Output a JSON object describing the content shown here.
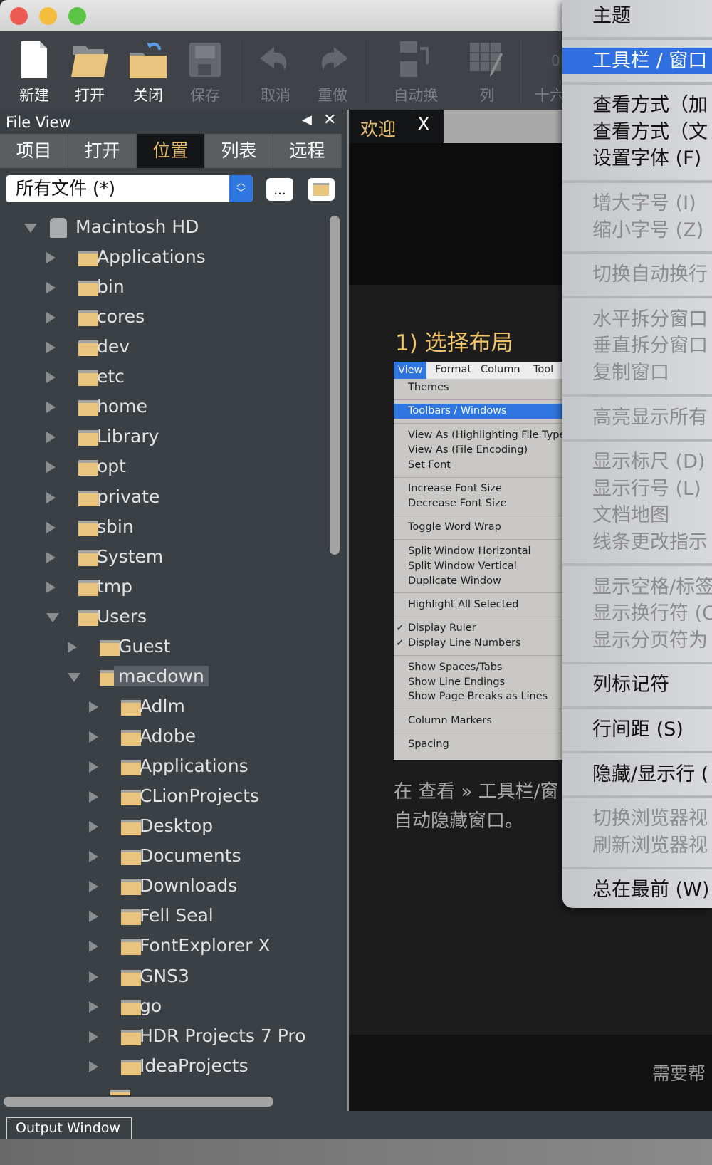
{
  "colors": {
    "accent": "#e8c170",
    "selection": "#2f76e0",
    "folder": "#e9c47d"
  },
  "toolbar": {
    "items": [
      {
        "label": "新建",
        "icon": "new-file-icon",
        "enabled": true
      },
      {
        "label": "打开",
        "icon": "open-folder-icon",
        "enabled": true
      },
      {
        "label": "关闭",
        "icon": "close-folder-icon",
        "enabled": true
      },
      {
        "label": "保存",
        "icon": "save-icon",
        "enabled": false
      },
      {
        "label": "取消",
        "icon": "undo-icon",
        "enabled": false
      },
      {
        "label": "重做",
        "icon": "redo-icon",
        "enabled": false
      },
      {
        "label": "自动换行",
        "icon": "word-wrap-icon",
        "enabled": false
      },
      {
        "label": "列",
        "icon": "column-icon",
        "enabled": false
      },
      {
        "label": "十六",
        "icon": "hex-icon",
        "enabled": false
      }
    ]
  },
  "file_view": {
    "title": "File View",
    "tabs": [
      "项目",
      "打开",
      "位置",
      "列表",
      "远程"
    ],
    "active_tab": "位置",
    "filter": "所有文件 (*)",
    "browse_label": "...",
    "tree": [
      {
        "label": "Macintosh HD",
        "depth": 0,
        "expanded": true,
        "icon": "disk"
      },
      {
        "label": "Applications",
        "depth": 1
      },
      {
        "label": "bin",
        "depth": 1
      },
      {
        "label": "cores",
        "depth": 1
      },
      {
        "label": "dev",
        "depth": 1
      },
      {
        "label": "etc",
        "depth": 1
      },
      {
        "label": "home",
        "depth": 1
      },
      {
        "label": "Library",
        "depth": 1
      },
      {
        "label": "opt",
        "depth": 1
      },
      {
        "label": "private",
        "depth": 1
      },
      {
        "label": "sbin",
        "depth": 1
      },
      {
        "label": "System",
        "depth": 1
      },
      {
        "label": "tmp",
        "depth": 1
      },
      {
        "label": "Users",
        "depth": 1,
        "expanded": true
      },
      {
        "label": "Guest",
        "depth": 2
      },
      {
        "label": "macdown",
        "depth": 2,
        "expanded": true,
        "selected": true
      },
      {
        "label": "Adlm",
        "depth": 3
      },
      {
        "label": "Adobe",
        "depth": 3
      },
      {
        "label": "Applications",
        "depth": 3
      },
      {
        "label": "CLionProjects",
        "depth": 3
      },
      {
        "label": "Desktop",
        "depth": 3
      },
      {
        "label": "Documents",
        "depth": 3
      },
      {
        "label": "Downloads",
        "depth": 3
      },
      {
        "label": "Fell Seal",
        "depth": 3
      },
      {
        "label": "FontExplorer X",
        "depth": 3
      },
      {
        "label": "GNS3",
        "depth": 3
      },
      {
        "label": "go",
        "depth": 3
      },
      {
        "label": "HDR Projects 7 Pro",
        "depth": 3
      },
      {
        "label": "IdeaProjects",
        "depth": 3
      }
    ]
  },
  "editor": {
    "tab_label": "欢迎",
    "tab_close": "X",
    "heading": "1) 选择布局",
    "screenshot_menubar": [
      "View",
      "Format",
      "Column",
      "Tool"
    ],
    "screenshot_menu": [
      [
        {
          "label": "Themes"
        }
      ],
      [
        {
          "label": "Toolbars / Windows",
          "highlighted": true
        }
      ],
      [
        {
          "label": "View As (Highlighting File Type"
        },
        {
          "label": "View As (File Encoding)"
        },
        {
          "label": "Set Font"
        }
      ],
      [
        {
          "label": "Increase Font Size"
        },
        {
          "label": "Decrease Font Size"
        }
      ],
      [
        {
          "label": "Toggle Word Wrap"
        }
      ],
      [
        {
          "label": "Split Window Horizontal"
        },
        {
          "label": "Split Window Vertical"
        },
        {
          "label": "Duplicate Window"
        }
      ],
      [
        {
          "label": "Highlight All Selected"
        }
      ],
      [
        {
          "label": "Display Ruler",
          "checked": true
        },
        {
          "label": "Display Line Numbers",
          "checked": true
        }
      ],
      [
        {
          "label": "Show Spaces/Tabs"
        },
        {
          "label": "Show Line Endings"
        },
        {
          "label": "Show Page Breaks as Lines"
        }
      ],
      [
        {
          "label": "Column Markers"
        }
      ],
      [
        {
          "label": "Spacing"
        }
      ]
    ],
    "caption_line1": "在 查看 » 工具栏/窗",
    "caption_line2": "自动隐藏窗口。",
    "help_text": "需要帮"
  },
  "view_menu": [
    [
      {
        "label": "主题"
      }
    ],
    [
      {
        "label": "工具栏 / 窗口",
        "highlighted": true
      }
    ],
    [
      {
        "label": "查看方式（加"
      },
      {
        "label": "查看方式（文"
      },
      {
        "label": "设置字体 (F)"
      }
    ],
    [
      {
        "label": "增大字号 (I)",
        "disabled": true
      },
      {
        "label": "缩小字号 (Z)",
        "disabled": true
      }
    ],
    [
      {
        "label": "切换自动换行",
        "disabled": true
      }
    ],
    [
      {
        "label": "水平拆分窗口",
        "disabled": true
      },
      {
        "label": "垂直拆分窗口",
        "disabled": true
      },
      {
        "label": "复制窗口",
        "disabled": true
      }
    ],
    [
      {
        "label": "高亮显示所有",
        "disabled": true
      }
    ],
    [
      {
        "label": "显示标尺 (D)",
        "disabled": true
      },
      {
        "label": "显示行号 (L)",
        "disabled": true
      },
      {
        "label": "文档地图",
        "disabled": true
      },
      {
        "label": "线条更改指示",
        "disabled": true
      }
    ],
    [
      {
        "label": "显示空格/标签",
        "disabled": true
      },
      {
        "label": "显示换行符 (C",
        "disabled": true
      },
      {
        "label": "显示分页符为",
        "disabled": true
      }
    ],
    [
      {
        "label": "列标记符"
      }
    ],
    [
      {
        "label": "行间距 (S)"
      }
    ],
    [
      {
        "label": "隐藏/显示行 ("
      }
    ],
    [
      {
        "label": "切换浏览器视",
        "disabled": true
      },
      {
        "label": "刷新浏览器视",
        "disabled": true
      }
    ],
    [
      {
        "label": "总在最前 (W)"
      }
    ]
  ],
  "output_window": {
    "label": "Output Window"
  }
}
